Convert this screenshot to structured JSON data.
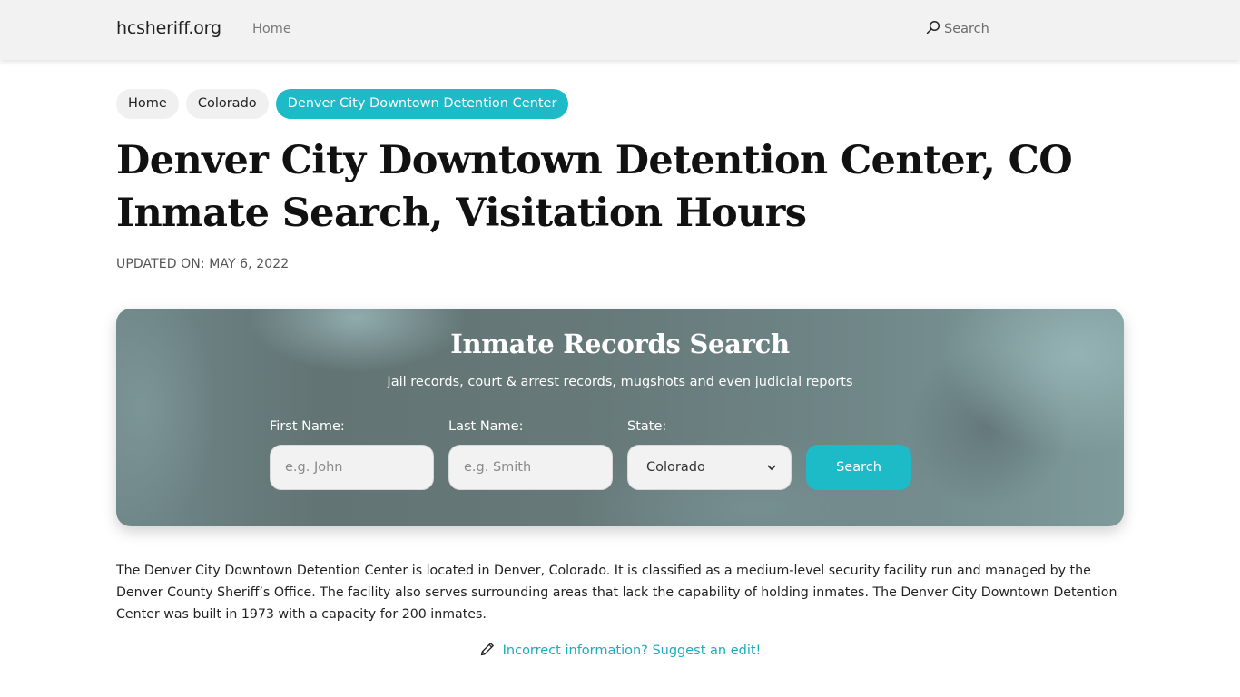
{
  "navbar": {
    "brand": "hcsheriff.org",
    "home_label": "Home",
    "search_label": "Search",
    "search_icon": "search-icon"
  },
  "breadcrumb": [
    {
      "label": "Home",
      "active": false
    },
    {
      "label": "Colorado",
      "active": false
    },
    {
      "label": "Denver City Downtown Detention Center",
      "active": true
    }
  ],
  "page": {
    "title_line1": "Denver City Downtown Detention Center, CO",
    "title_line2": "Inmate Search, Visitation Hours",
    "updated": "UPDATED ON: MAY 6, 2022"
  },
  "search_panel": {
    "title": "Inmate Records Search",
    "subtitle": "Jail records, court & arrest records, mugshots and even judicial reports",
    "first_name": {
      "label": "First Name:",
      "placeholder": "e.g. John",
      "value": ""
    },
    "last_name": {
      "label": "Last Name:",
      "placeholder": "e.g. Smith",
      "value": ""
    },
    "state": {
      "label": "State:",
      "selected": "Colorado",
      "icon": "chevron-down-icon"
    },
    "submit_label": "Search"
  },
  "description": "The Denver City Downtown Detention Center is located in Denver, Colorado. It is classified as a medium-level security facility run and managed by the Denver County Sheriff’s Office. The facility also serves surrounding areas that lack the capability of holding inmates. The Denver City Downtown Detention Center was built in 1973 with a capacity for 200 inmates.",
  "suggest_edit": {
    "label": "Incorrect information? Suggest an edit!",
    "icon": "pencil-icon"
  },
  "colors": {
    "accent": "#1dbac8",
    "navbar_bg": "#f2f2f2",
    "link": "#1dabb8",
    "panel_bg": "#667878"
  }
}
